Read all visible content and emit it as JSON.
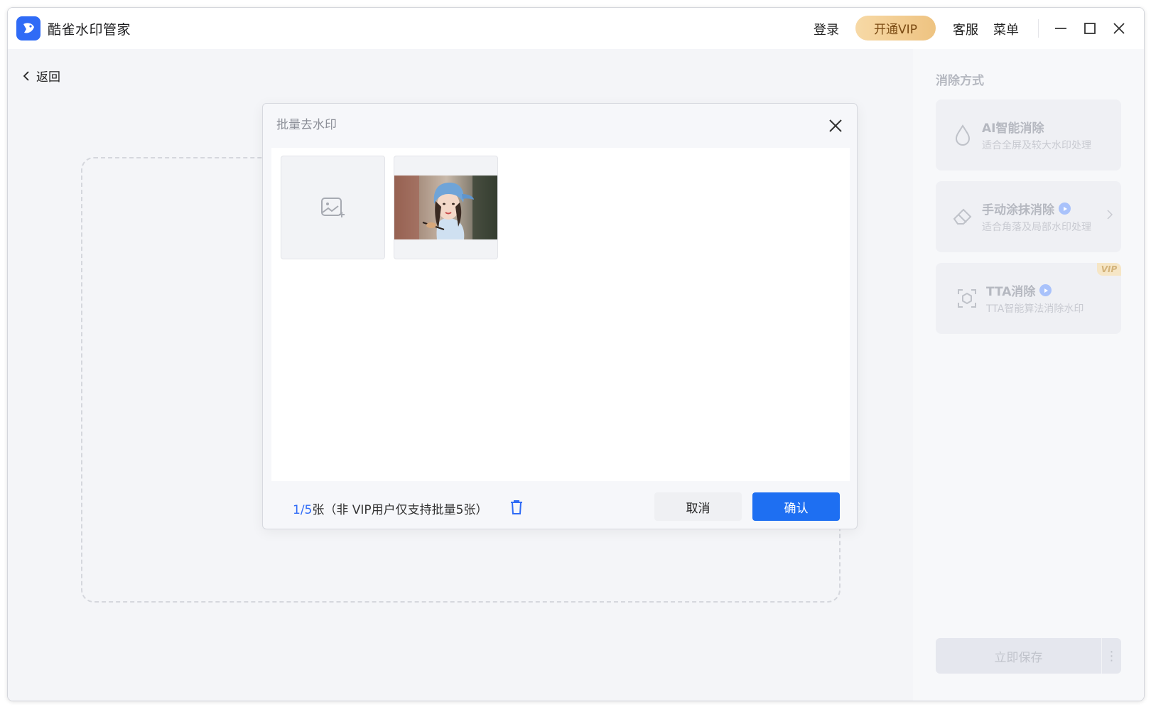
{
  "app": {
    "title": "酷雀水印管家"
  },
  "titlebar": {
    "login": "登录",
    "vip": "开通VIP",
    "service": "客服",
    "menu": "菜单"
  },
  "main": {
    "back_label": "返回"
  },
  "modal": {
    "title": "批量去水印",
    "count_current": "1",
    "count_total": "/5",
    "count_note": "张（非 VIP用户仅支持批量5张）",
    "cancel": "取消",
    "confirm": "确认"
  },
  "sidebar": {
    "title": "消除方式",
    "cards": [
      {
        "title": "AI智能消除",
        "subtitle": "适合全屏及较大水印处理",
        "icon": "droplet-icon"
      },
      {
        "title": "手动涂抹消除",
        "subtitle": "适合角落及局部水印处理",
        "icon": "eraser-icon"
      },
      {
        "title": "TTA消除",
        "subtitle": "TTA智能算法消除水印",
        "icon": "scan-box-icon",
        "badge": "VIP"
      }
    ],
    "save": "立即保存"
  },
  "colors": {
    "primary": "#1e6ff2",
    "vip_gold": "#eec381"
  }
}
